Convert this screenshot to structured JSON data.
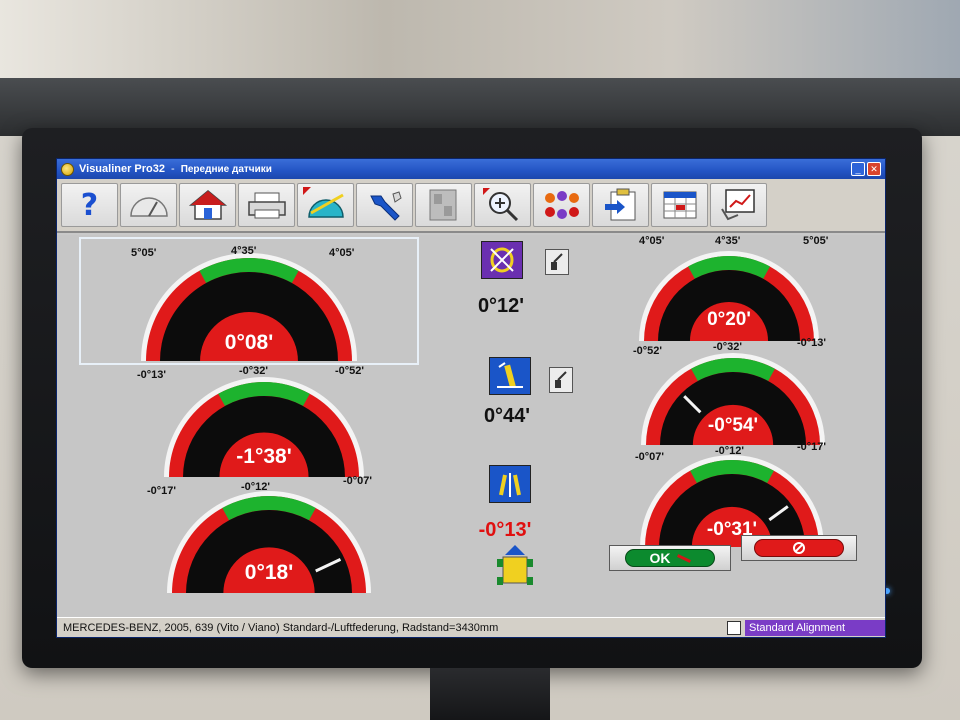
{
  "window": {
    "title": "Visualiner Pro32",
    "subtitle": "Передние датчики"
  },
  "toolbar": {
    "tools": [
      {
        "name": "help",
        "icon": "question-icon"
      },
      {
        "name": "gauge",
        "icon": "speedometer-icon"
      },
      {
        "name": "home",
        "icon": "house-icon"
      },
      {
        "name": "print",
        "icon": "printer-icon"
      },
      {
        "name": "angle",
        "icon": "protractor-icon"
      },
      {
        "name": "tools",
        "icon": "wrench-icon"
      },
      {
        "name": "layout",
        "icon": "layout-icon"
      },
      {
        "name": "zoom",
        "icon": "zoom-in-icon"
      },
      {
        "name": "sensors",
        "icon": "sensor-dots-icon"
      },
      {
        "name": "export",
        "icon": "clipboard-arrow-icon"
      },
      {
        "name": "table",
        "icon": "spreadsheet-icon"
      },
      {
        "name": "report",
        "icon": "chart-report-icon"
      }
    ]
  },
  "gauges": {
    "left_top": {
      "min": "5°05'",
      "center": "4°35'",
      "max": "4°05'",
      "value": "0°08'",
      "needle": null
    },
    "right_top": {
      "min": "4°05'",
      "center": "4°35'",
      "max": "5°05'",
      "value": "0°20'",
      "needle": null
    },
    "left_mid": {
      "min": "-0°13'",
      "center": "-0°32'",
      "max": "-0°52'",
      "value": "-1°38'",
      "needle": null
    },
    "right_mid": {
      "min": "-0°52'",
      "center": "-0°32'",
      "max": "-0°13'",
      "value": "-0°54'",
      "needle": 0.25
    },
    "left_bottom": {
      "min": "-0°17'",
      "center": "-0°12'",
      "max": "-0°07'",
      "value": "0°18'",
      "needle": 0.86
    },
    "right_bottom": {
      "min": "-0°07'",
      "center": "-0°12'",
      "max": "-0°17'",
      "value": "-0°31'",
      "needle": 0.8
    }
  },
  "center": {
    "top_value": "0°12'",
    "mid_value": "0°44'",
    "bottom_value": "-0°13'"
  },
  "buttons": {
    "ok": "OK"
  },
  "status": {
    "vehicle": "MERCEDES-BENZ, 2005, 639 (Vito / Viano) Standard-/Luftfederung, Radstand=3430mm",
    "mode": "Standard Alignment"
  },
  "colors": {
    "gauge_red": "#e01a1a",
    "gauge_green": "#1db32e",
    "gauge_black": "#0c0c0c",
    "title_blue": "#2354c4",
    "status_purple": "#7a3cc6"
  }
}
